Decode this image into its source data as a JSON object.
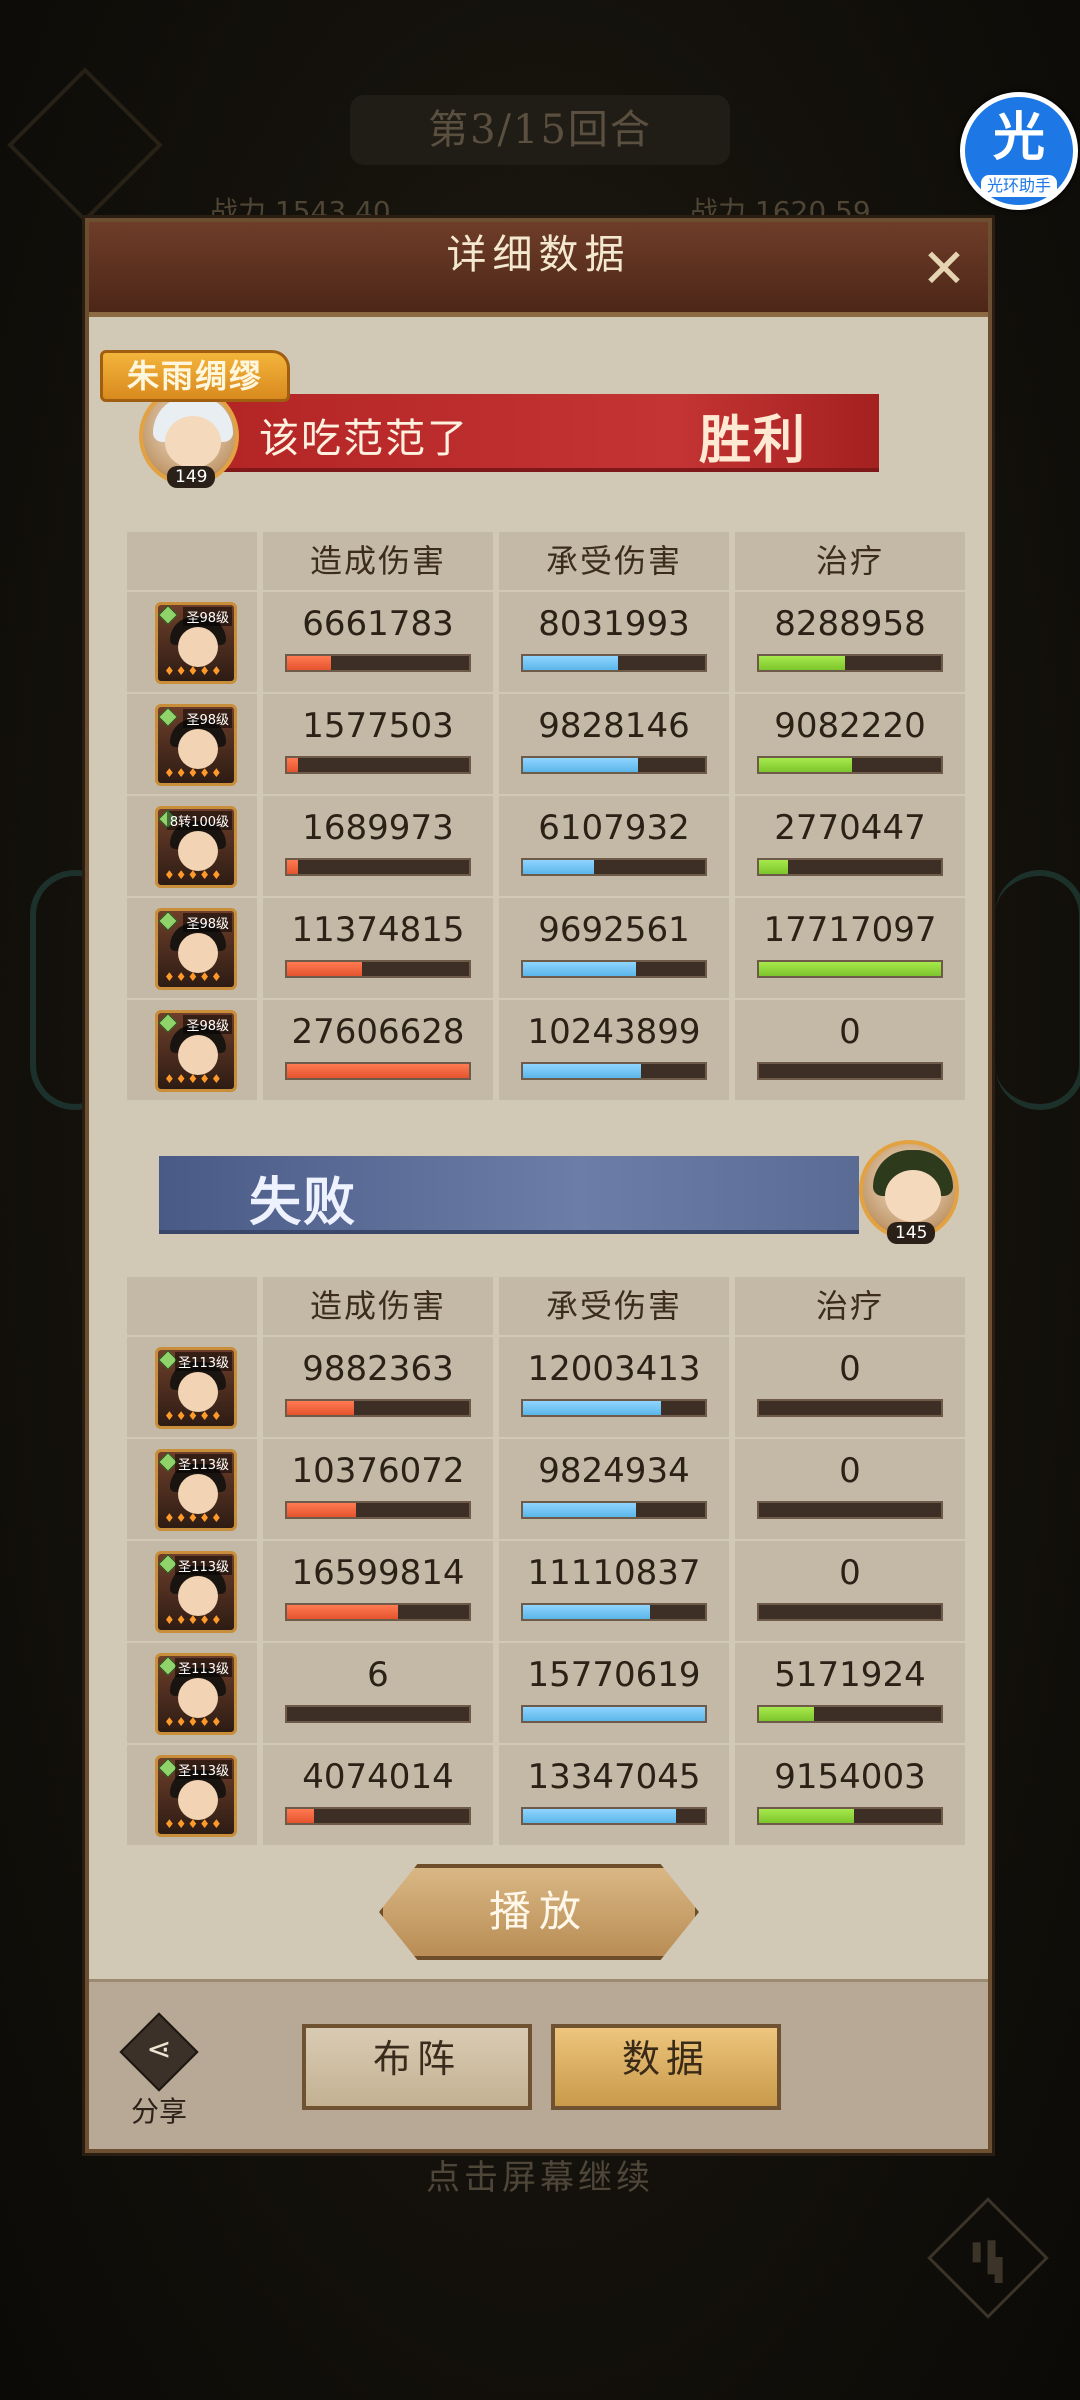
{
  "background": {
    "round_text": "第3/15回合",
    "left_stat": "战力 1543.40",
    "right_stat": "战力 1620.59",
    "continue_hint": "点击屏幕继续"
  },
  "app_badge": {
    "glyph": "光",
    "label": "光环助手"
  },
  "dialog": {
    "title": "详细数据",
    "close_icon": "close-icon"
  },
  "columns": [
    "造成伤害",
    "承受伤害",
    "治疗"
  ],
  "team_win": {
    "tag": "朱雨绸缪",
    "player_name": "该吃范范了",
    "result": "胜利",
    "level": "149",
    "heroes": [
      {
        "hero_level": "圣98级",
        "damage": "6661783",
        "damage_ratio": 0.24,
        "taken": "8031993",
        "taken_ratio": 0.52,
        "heal": "8288958",
        "heal_ratio": 0.47
      },
      {
        "hero_level": "圣98级",
        "damage": "1577503",
        "damage_ratio": 0.06,
        "taken": "9828146",
        "taken_ratio": 0.63,
        "heal": "9082220",
        "heal_ratio": 0.51
      },
      {
        "hero_level": "8转100级",
        "damage": "1689973",
        "damage_ratio": 0.06,
        "taken": "6107932",
        "taken_ratio": 0.39,
        "heal": "2770447",
        "heal_ratio": 0.16
      },
      {
        "hero_level": "圣98级",
        "damage": "11374815",
        "damage_ratio": 0.41,
        "taken": "9692561",
        "taken_ratio": 0.62,
        "heal": "17717097",
        "heal_ratio": 1.0
      },
      {
        "hero_level": "圣98级",
        "damage": "27606628",
        "damage_ratio": 1.0,
        "taken": "10243899",
        "taken_ratio": 0.65,
        "heal": "0",
        "heal_ratio": 0
      }
    ]
  },
  "team_lose": {
    "result": "失败",
    "player_name": "",
    "level": "145",
    "heroes": [
      {
        "hero_level": "圣113级",
        "damage": "9882363",
        "damage_ratio": 0.37,
        "taken": "12003413",
        "taken_ratio": 0.76,
        "heal": "0",
        "heal_ratio": 0
      },
      {
        "hero_level": "圣113级",
        "damage": "10376072",
        "damage_ratio": 0.38,
        "taken": "9824934",
        "taken_ratio": 0.62,
        "heal": "0",
        "heal_ratio": 0
      },
      {
        "hero_level": "圣113级",
        "damage": "16599814",
        "damage_ratio": 0.61,
        "taken": "11110837",
        "taken_ratio": 0.7,
        "heal": "0",
        "heal_ratio": 0
      },
      {
        "hero_level": "圣113级",
        "damage": "6",
        "damage_ratio": 0,
        "taken": "15770619",
        "taken_ratio": 1.0,
        "heal": "5171924",
        "heal_ratio": 0.3
      },
      {
        "hero_level": "圣113级",
        "damage": "4074014",
        "damage_ratio": 0.15,
        "taken": "13347045",
        "taken_ratio": 0.84,
        "heal": "9154003",
        "heal_ratio": 0.52
      }
    ]
  },
  "play_button": "播放",
  "footer": {
    "share_label": "分享",
    "lineup_label": "布阵",
    "data_label": "数据"
  },
  "colors": {
    "damage_bar": "#e4542e",
    "taken_bar": "#5bb6e9",
    "heal_bar": "#7cc52c",
    "win_ribbon": "#c43434",
    "lose_ribbon": "#6c7ea8"
  }
}
